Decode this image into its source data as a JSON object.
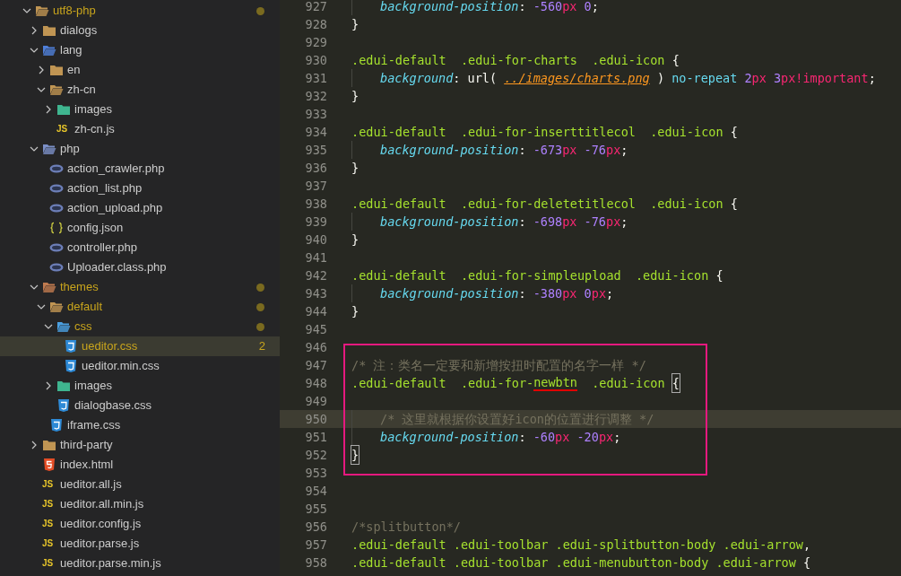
{
  "explorer": {
    "tree": [
      {
        "name": "utf8-php",
        "kind": "folder-root",
        "expanded": true,
        "modified": true,
        "selected": false,
        "children": [
          {
            "name": "dialogs",
            "kind": "folder",
            "expanded": false,
            "modified": false,
            "selected": false
          },
          {
            "name": "lang",
            "kind": "folder-lang",
            "expanded": true,
            "modified": false,
            "selected": false,
            "children": [
              {
                "name": "en",
                "kind": "folder",
                "expanded": false,
                "modified": false,
                "selected": false
              },
              {
                "name": "zh-cn",
                "kind": "folder",
                "expanded": true,
                "modified": false,
                "selected": false,
                "children": [
                  {
                    "name": "images",
                    "kind": "folder-images",
                    "expanded": false,
                    "modified": false,
                    "selected": false
                  },
                  {
                    "name": "zh-cn.js",
                    "kind": "js",
                    "icon_label": "JS",
                    "modified": false,
                    "selected": false
                  }
                ]
              }
            ]
          },
          {
            "name": "php",
            "kind": "folder-php",
            "expanded": true,
            "modified": false,
            "selected": false,
            "children": [
              {
                "name": "action_crawler.php",
                "kind": "php",
                "modified": false,
                "selected": false
              },
              {
                "name": "action_list.php",
                "kind": "php",
                "modified": false,
                "selected": false
              },
              {
                "name": "action_upload.php",
                "kind": "php",
                "modified": false,
                "selected": false
              },
              {
                "name": "config.json",
                "kind": "json",
                "modified": false,
                "selected": false
              },
              {
                "name": "controller.php",
                "kind": "php",
                "modified": false,
                "selected": false
              },
              {
                "name": "Uploader.class.php",
                "kind": "php",
                "modified": false,
                "selected": false
              }
            ]
          },
          {
            "name": "themes",
            "kind": "folder-themes",
            "expanded": true,
            "modified": true,
            "selected": false,
            "children": [
              {
                "name": "default",
                "kind": "folder",
                "expanded": true,
                "modified": true,
                "selected": false,
                "children": [
                  {
                    "name": "css",
                    "kind": "folder-css",
                    "expanded": true,
                    "modified": true,
                    "selected": false,
                    "children": [
                      {
                        "name": "ueditor.css",
                        "kind": "css",
                        "modified": true,
                        "selected": true,
                        "badge": "2"
                      },
                      {
                        "name": "ueditor.min.css",
                        "kind": "css",
                        "modified": false,
                        "selected": false
                      }
                    ]
                  },
                  {
                    "name": "images",
                    "kind": "folder-images",
                    "expanded": false,
                    "modified": false,
                    "selected": false
                  },
                  {
                    "name": "dialogbase.css",
                    "kind": "css",
                    "modified": false,
                    "selected": false
                  }
                ]
              },
              {
                "name": "iframe.css",
                "kind": "css",
                "modified": false,
                "selected": false
              }
            ]
          },
          {
            "name": "third-party",
            "kind": "folder",
            "expanded": false,
            "modified": false,
            "selected": false
          },
          {
            "name": "index.html",
            "kind": "html",
            "modified": false,
            "selected": false
          },
          {
            "name": "ueditor.all.js",
            "kind": "js",
            "icon_label": "JS",
            "modified": false,
            "selected": false
          },
          {
            "name": "ueditor.all.min.js",
            "kind": "js",
            "icon_label": "JS",
            "modified": false,
            "selected": false
          },
          {
            "name": "ueditor.config.js",
            "kind": "js",
            "icon_label": "JS",
            "modified": false,
            "selected": false
          },
          {
            "name": "ueditor.parse.js",
            "kind": "js",
            "icon_label": "JS",
            "modified": false,
            "selected": false
          },
          {
            "name": "ueditor.parse.min.js",
            "kind": "js",
            "icon_label": "JS",
            "modified": false,
            "selected": false
          }
        ]
      }
    ]
  },
  "editor": {
    "lines": [
      {
        "number": "927",
        "indented": true,
        "current": false,
        "boxed": false,
        "tokens": [
          {
            "kind": "property",
            "text": "background-position"
          },
          {
            "kind": "punct",
            "text": ": "
          },
          {
            "kind": "number",
            "text": "-560"
          },
          {
            "kind": "unit",
            "text": "px"
          },
          {
            "kind": "number",
            "text": " 0"
          },
          {
            "kind": "punct",
            "text": ";"
          }
        ]
      },
      {
        "number": "928",
        "indented": false,
        "current": false,
        "boxed": false,
        "tokens": [
          {
            "kind": "punct",
            "text": "}"
          }
        ]
      },
      {
        "number": "929",
        "indented": false,
        "current": false,
        "boxed": false
      },
      {
        "number": "930",
        "indented": false,
        "current": false,
        "boxed": false,
        "tokens": [
          {
            "kind": "selector",
            "text": ".edui-default  .edui-for-charts  .edui-icon"
          },
          {
            "kind": "punct",
            "text": " {"
          }
        ]
      },
      {
        "number": "931",
        "indented": true,
        "current": false,
        "boxed": false,
        "tokens": [
          {
            "kind": "property",
            "text": "background"
          },
          {
            "kind": "punct",
            "text": ": url( "
          },
          {
            "kind": "link",
            "text": "../images/charts.png"
          },
          {
            "kind": "punct",
            "text": " ) "
          },
          {
            "kind": "keyword",
            "text": "no-repeat"
          },
          {
            "kind": "number",
            "text": " 2"
          },
          {
            "kind": "unit",
            "text": "px"
          },
          {
            "kind": "number",
            "text": " 3"
          },
          {
            "kind": "unit",
            "text": "px!important"
          },
          {
            "kind": "punct",
            "text": ";"
          }
        ]
      },
      {
        "number": "932",
        "indented": false,
        "current": false,
        "boxed": false,
        "tokens": [
          {
            "kind": "punct",
            "text": "}"
          }
        ]
      },
      {
        "number": "933",
        "indented": false,
        "current": false,
        "boxed": false
      },
      {
        "number": "934",
        "indented": false,
        "current": false,
        "boxed": false,
        "tokens": [
          {
            "kind": "selector",
            "text": ".edui-default  .edui-for-inserttitlecol  .edui-icon"
          },
          {
            "kind": "punct",
            "text": " {"
          }
        ]
      },
      {
        "number": "935",
        "indented": true,
        "current": false,
        "boxed": false,
        "tokens": [
          {
            "kind": "property",
            "text": "background-position"
          },
          {
            "kind": "punct",
            "text": ": "
          },
          {
            "kind": "number",
            "text": "-673"
          },
          {
            "kind": "unit",
            "text": "px"
          },
          {
            "kind": "number",
            "text": " -76"
          },
          {
            "kind": "unit",
            "text": "px"
          },
          {
            "kind": "punct",
            "text": ";"
          }
        ]
      },
      {
        "number": "936",
        "indented": false,
        "current": false,
        "boxed": false,
        "tokens": [
          {
            "kind": "punct",
            "text": "}"
          }
        ]
      },
      {
        "number": "937",
        "indented": false,
        "current": false,
        "boxed": false
      },
      {
        "number": "938",
        "indented": false,
        "current": false,
        "boxed": false,
        "tokens": [
          {
            "kind": "selector",
            "text": ".edui-default  .edui-for-deletetitlecol  .edui-icon"
          },
          {
            "kind": "punct",
            "text": " {"
          }
        ]
      },
      {
        "number": "939",
        "indented": true,
        "current": false,
        "boxed": false,
        "tokens": [
          {
            "kind": "property",
            "text": "background-position"
          },
          {
            "kind": "punct",
            "text": ": "
          },
          {
            "kind": "number",
            "text": "-698"
          },
          {
            "kind": "unit",
            "text": "px"
          },
          {
            "kind": "number",
            "text": " -76"
          },
          {
            "kind": "unit",
            "text": "px"
          },
          {
            "kind": "punct",
            "text": ";"
          }
        ]
      },
      {
        "number": "940",
        "indented": false,
        "current": false,
        "boxed": false,
        "tokens": [
          {
            "kind": "punct",
            "text": "}"
          }
        ]
      },
      {
        "number": "941",
        "indented": false,
        "current": false,
        "boxed": false
      },
      {
        "number": "942",
        "indented": false,
        "current": false,
        "boxed": false,
        "tokens": [
          {
            "kind": "selector",
            "text": ".edui-default  .edui-for-simpleupload  .edui-icon"
          },
          {
            "kind": "punct",
            "text": " {"
          }
        ]
      },
      {
        "number": "943",
        "indented": true,
        "current": false,
        "boxed": false,
        "tokens": [
          {
            "kind": "property",
            "text": "background-position"
          },
          {
            "kind": "punct",
            "text": ": "
          },
          {
            "kind": "number",
            "text": "-380"
          },
          {
            "kind": "unit",
            "text": "px"
          },
          {
            "kind": "number",
            "text": " 0"
          },
          {
            "kind": "unit",
            "text": "px"
          },
          {
            "kind": "punct",
            "text": ";"
          }
        ]
      },
      {
        "number": "944",
        "indented": false,
        "current": false,
        "boxed": false,
        "tokens": [
          {
            "kind": "punct",
            "text": "}"
          }
        ]
      },
      {
        "number": "945",
        "indented": false,
        "current": false,
        "boxed": false
      },
      {
        "number": "946",
        "indented": false,
        "current": false,
        "boxed": true
      },
      {
        "number": "947",
        "indented": false,
        "current": false,
        "boxed": true,
        "tokens": [
          {
            "kind": "comment",
            "text": "/* 注：类名一定要和新增按扭时配置的名字一样 */"
          }
        ]
      },
      {
        "number": "948",
        "indented": false,
        "current": false,
        "boxed": true,
        "tokens": [
          {
            "kind": "selector",
            "text": ".edui-default  .edui-for-"
          },
          {
            "kind": "selector",
            "text": "newbtn",
            "underlined": true
          },
          {
            "kind": "selector",
            "text": "  .edui-icon "
          },
          {
            "kind": "bracket",
            "text": "{"
          }
        ]
      },
      {
        "number": "949",
        "indented": false,
        "current": false,
        "boxed": true
      },
      {
        "number": "950",
        "indented": true,
        "current": true,
        "boxed": true,
        "tokens": [
          {
            "kind": "comment",
            "text": "/* 这里就根据你设置好icon的位置进行调整 */"
          }
        ]
      },
      {
        "number": "951",
        "indented": true,
        "current": false,
        "boxed": true,
        "tokens": [
          {
            "kind": "property",
            "text": "background-position"
          },
          {
            "kind": "punct",
            "text": ": "
          },
          {
            "kind": "number",
            "text": "-60"
          },
          {
            "kind": "unit",
            "text": "px"
          },
          {
            "kind": "number",
            "text": " -20"
          },
          {
            "kind": "unit",
            "text": "px"
          },
          {
            "kind": "punct",
            "text": ";"
          }
        ]
      },
      {
        "number": "952",
        "indented": false,
        "current": false,
        "boxed": true,
        "tokens": [
          {
            "kind": "bracket",
            "text": "}"
          }
        ]
      },
      {
        "number": "953",
        "indented": false,
        "current": false,
        "boxed": true
      },
      {
        "number": "954",
        "indented": false,
        "current": false,
        "boxed": false
      },
      {
        "number": "955",
        "indented": false,
        "current": false,
        "boxed": false
      },
      {
        "number": "956",
        "indented": false,
        "current": false,
        "boxed": false,
        "tokens": [
          {
            "kind": "comment",
            "text": "/*splitbutton*/"
          }
        ]
      },
      {
        "number": "957",
        "indented": false,
        "current": false,
        "boxed": false,
        "tokens": [
          {
            "kind": "selector",
            "text": ".edui-default .edui-toolbar .edui-splitbutton-body .edui-arrow"
          },
          {
            "kind": "punct",
            "text": ","
          }
        ]
      },
      {
        "number": "958",
        "indented": false,
        "current": false,
        "boxed": false,
        "tokens": [
          {
            "kind": "selector",
            "text": ".edui-default .edui-toolbar .edui-menubutton-body .edui-arrow"
          },
          {
            "kind": "punct",
            "text": " {"
          }
        ]
      }
    ]
  }
}
